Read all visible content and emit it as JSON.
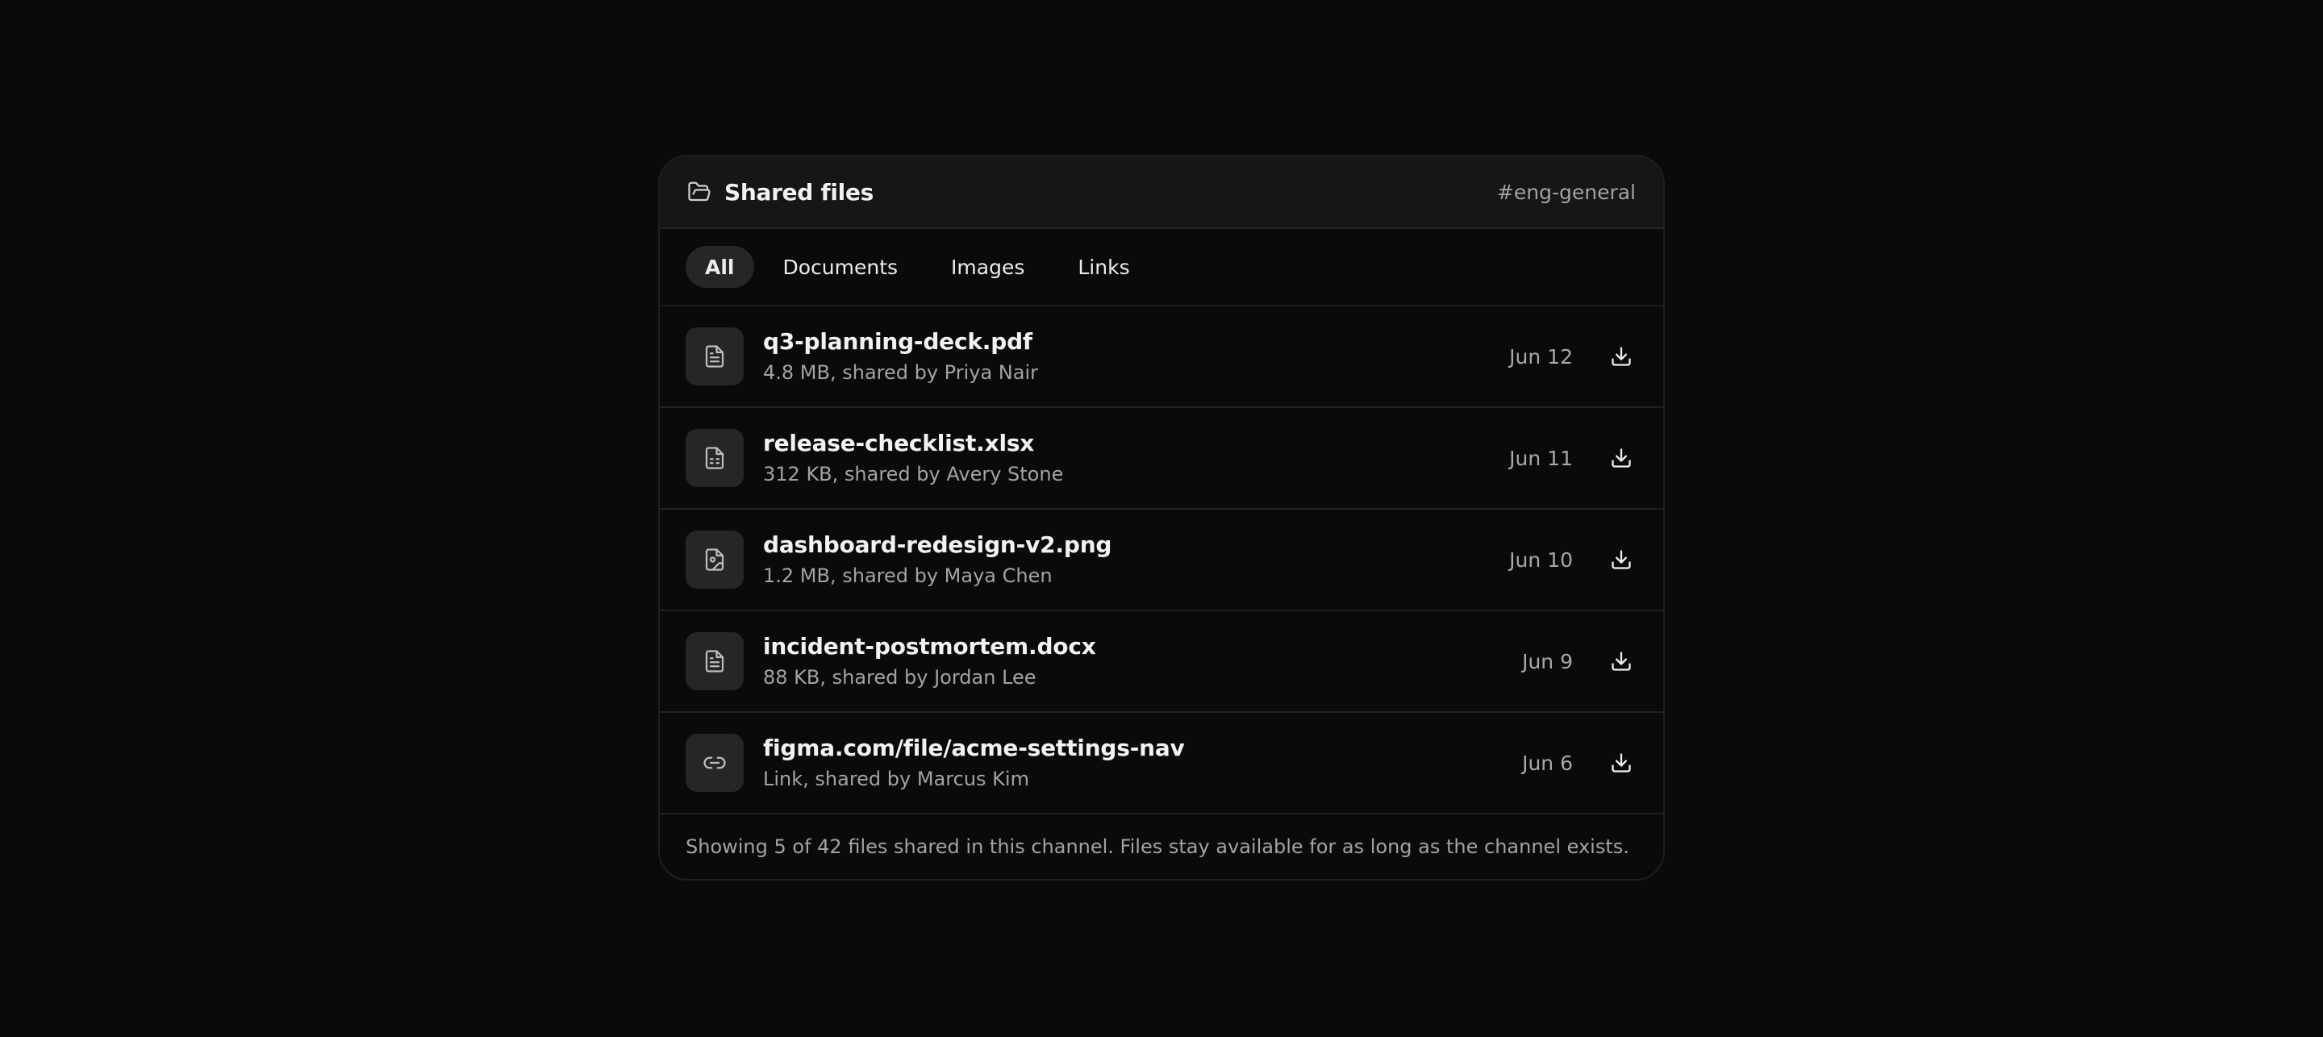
{
  "header": {
    "title": "Shared files",
    "channel": "#eng-general",
    "icon": "folder-open-icon"
  },
  "tabs": [
    {
      "label": "All",
      "active": true
    },
    {
      "label": "Documents",
      "active": false
    },
    {
      "label": "Images",
      "active": false
    },
    {
      "label": "Links",
      "active": false
    }
  ],
  "files": [
    {
      "name": "q3-planning-deck.pdf",
      "sub": "4.8 MB, shared by Priya Nair",
      "date": "Jun 12",
      "icon": "document-icon"
    },
    {
      "name": "release-checklist.xlsx",
      "sub": "312 KB, shared by Avery Stone",
      "date": "Jun 11",
      "icon": "spreadsheet-icon"
    },
    {
      "name": "dashboard-redesign-v2.png",
      "sub": "1.2 MB, shared by Maya Chen",
      "date": "Jun 10",
      "icon": "image-file-icon"
    },
    {
      "name": "incident-postmortem.docx",
      "sub": "88 KB, shared by Jordan Lee",
      "date": "Jun 9",
      "icon": "document-icon"
    },
    {
      "name": "figma.com/file/acme-settings-nav",
      "sub": "Link, shared by Marcus Kim",
      "date": "Jun 6",
      "icon": "link-icon"
    }
  ],
  "footer": {
    "text": "Showing 5 of 42 files shared in this channel. Files stay available for as long as the channel exists."
  },
  "colors": {
    "background": "#0a0a0a",
    "header_bg": "#161616",
    "icon_tile": "#262626",
    "muted_text": "#a3a3a3"
  }
}
